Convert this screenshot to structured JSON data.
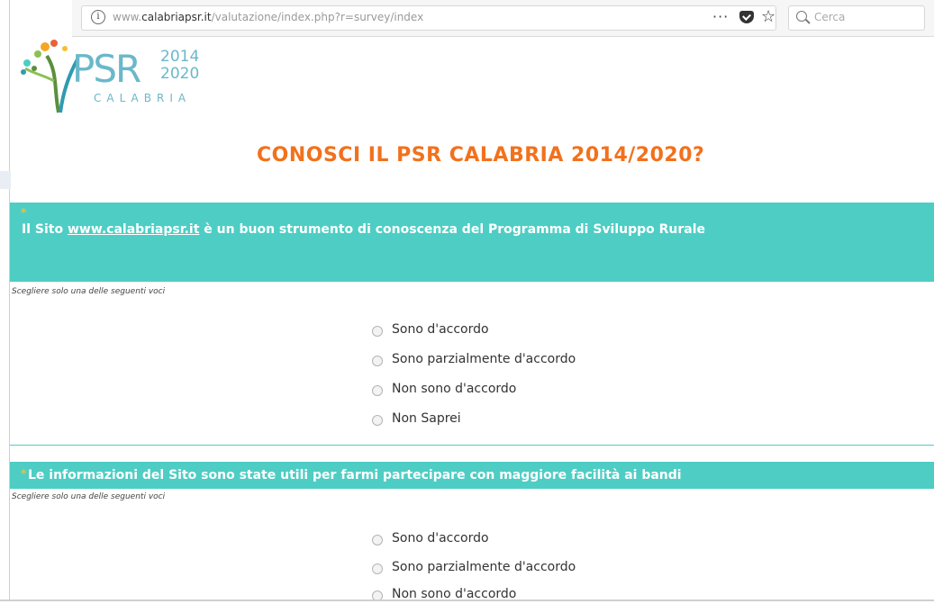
{
  "browser": {
    "url_prefix": "www.",
    "url_domain": "calabriapsr.it",
    "url_path": "/valutazione/index.php?r=survey/index",
    "search_placeholder": "Cerca",
    "menu_dots": "···",
    "info_glyph": "i"
  },
  "logo": {
    "main": "PSR",
    "year_start": "2014",
    "year_end": "2020",
    "region": "CALABRIA"
  },
  "survey": {
    "title": "CONOSCI IL PSR CALABRIA 2014/2020?"
  },
  "questions": [
    {
      "required_mark": "*",
      "text_prefix": "Il Sito ",
      "link": "www.calabriapsr.it",
      "text_suffix": " è un buon strumento di conoscenza del Programma di Sviluppo Rurale",
      "hint": "Scegliere solo una delle seguenti voci",
      "options": [
        "Sono d'accordo",
        "Sono parzialmente d'accordo",
        "Non sono d'accordo",
        "Non Saprei"
      ]
    },
    {
      "required_mark": "*",
      "text": "Le informazioni del Sito sono state utili per farmi partecipare con maggiore facilità ai bandi",
      "hint": "Scegliere solo una delle seguenti voci",
      "options": [
        "Sono d'accordo",
        "Sono parzialmente d'accordo",
        "Non sono d'accordo"
      ]
    }
  ],
  "colors": {
    "banner": "#4ecdc4",
    "title": "#f2711c",
    "logo": "#6ab8c9",
    "asterisk": "#f2c12e"
  }
}
